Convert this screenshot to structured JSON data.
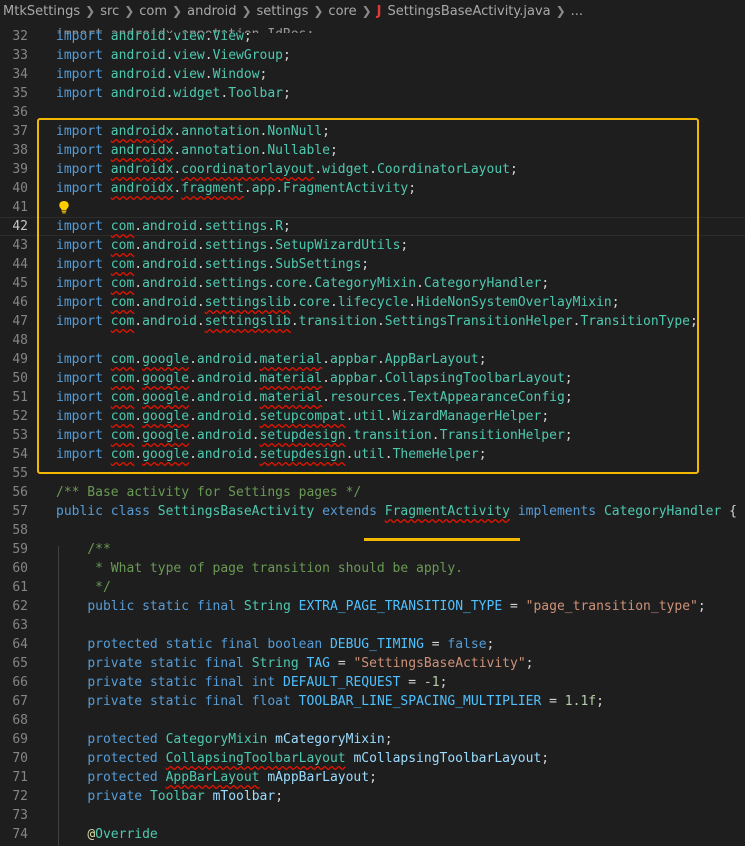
{
  "breadcrumb": {
    "items": [
      "MtkSettings",
      "src",
      "com",
      "android",
      "settings",
      "core"
    ],
    "file_icon": "J",
    "file_name": "SettingsBaseActivity.java",
    "trailing": "..."
  },
  "editor": {
    "top_partial_text": "import androidx.annotation.IdRes;",
    "lines": [
      {
        "n": "32",
        "code": "import android.view.View;"
      },
      {
        "n": "33",
        "code": "import android.view.ViewGroup;"
      },
      {
        "n": "34",
        "code": "import android.view.Window;"
      },
      {
        "n": "35",
        "code": "import android.widget.Toolbar;"
      },
      {
        "n": "36",
        "code": ""
      },
      {
        "n": "37",
        "code": "import androidx.annotation.NonNull;"
      },
      {
        "n": "38",
        "code": "import androidx.annotation.Nullable;"
      },
      {
        "n": "39",
        "code": "import androidx.coordinatorlayout.widget.CoordinatorLayout;"
      },
      {
        "n": "40",
        "code": "import androidx.fragment.app.FragmentActivity;"
      },
      {
        "n": "41",
        "code": ""
      },
      {
        "n": "42",
        "code": "import com.android.settings.R;"
      },
      {
        "n": "43",
        "code": "import com.android.settings.SetupWizardUtils;"
      },
      {
        "n": "44",
        "code": "import com.android.settings.SubSettings;"
      },
      {
        "n": "45",
        "code": "import com.android.settings.core.CategoryMixin.CategoryHandler;"
      },
      {
        "n": "46",
        "code": "import com.android.settingslib.core.lifecycle.HideNonSystemOverlayMixin;"
      },
      {
        "n": "47",
        "code": "import com.android.settingslib.transition.SettingsTransitionHelper.TransitionType;"
      },
      {
        "n": "48",
        "code": ""
      },
      {
        "n": "49",
        "code": "import com.google.android.material.appbar.AppBarLayout;"
      },
      {
        "n": "50",
        "code": "import com.google.android.material.appbar.CollapsingToolbarLayout;"
      },
      {
        "n": "51",
        "code": "import com.google.android.material.resources.TextAppearanceConfig;"
      },
      {
        "n": "52",
        "code": "import com.google.android.setupcompat.util.WizardManagerHelper;"
      },
      {
        "n": "53",
        "code": "import com.google.android.setupdesign.transition.TransitionHelper;"
      },
      {
        "n": "54",
        "code": "import com.google.android.setupdesign.util.ThemeHelper;"
      },
      {
        "n": "55",
        "code": ""
      },
      {
        "n": "56",
        "code": "/** Base activity for Settings pages */"
      },
      {
        "n": "57",
        "code": "public class SettingsBaseActivity extends FragmentActivity implements CategoryHandler {"
      },
      {
        "n": "58",
        "code": ""
      },
      {
        "n": "59",
        "code": "    /**"
      },
      {
        "n": "60",
        "code": "     * What type of page transition should be apply."
      },
      {
        "n": "61",
        "code": "     */"
      },
      {
        "n": "62",
        "code": "    public static final String EXTRA_PAGE_TRANSITION_TYPE = \"page_transition_type\";"
      },
      {
        "n": "63",
        "code": ""
      },
      {
        "n": "64",
        "code": "    protected static final boolean DEBUG_TIMING = false;"
      },
      {
        "n": "65",
        "code": "    private static final String TAG = \"SettingsBaseActivity\";"
      },
      {
        "n": "66",
        "code": "    private static final int DEFAULT_REQUEST = -1;"
      },
      {
        "n": "67",
        "code": "    private static final float TOOLBAR_LINE_SPACING_MULTIPLIER = 1.1f;"
      },
      {
        "n": "68",
        "code": ""
      },
      {
        "n": "69",
        "code": "    protected CategoryMixin mCategoryMixin;"
      },
      {
        "n": "70",
        "code": "    protected CollapsingToolbarLayout mCollapsingToolbarLayout;"
      },
      {
        "n": "71",
        "code": "    protected AppBarLayout mAppBarLayout;"
      },
      {
        "n": "72",
        "code": "    private Toolbar mToolbar;"
      },
      {
        "n": "73",
        "code": ""
      },
      {
        "n": "74",
        "code": "    @Override"
      }
    ]
  },
  "colors": {
    "background": "#1e1e1e",
    "keyword": "#569cd6",
    "type": "#4ec9b0",
    "comment": "#6a9955",
    "string": "#ce9178",
    "variable": "#9cdcfe",
    "constant": "#4fc1ff",
    "number": "#b5cea8",
    "highlight_annotation": "#f5b800",
    "error_squiggle": "#e51400"
  },
  "icons": {
    "lightbulb": "lightbulb-icon",
    "java_file": "java-file-icon",
    "chevron": "chevron-right-icon"
  }
}
